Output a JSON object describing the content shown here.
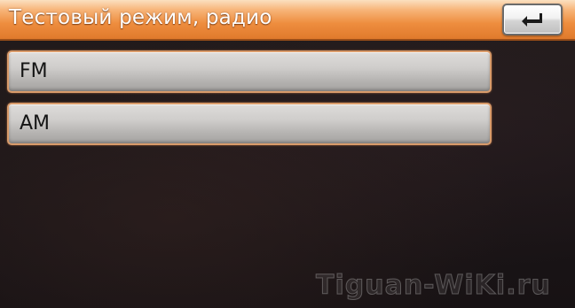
{
  "header": {
    "title": "Тестовый режим, радио",
    "back_icon": "back-return-icon"
  },
  "menu": {
    "items": [
      {
        "label": "FM"
      },
      {
        "label": "AM"
      }
    ]
  },
  "watermark": {
    "text": "Tiguan-WiKi.ru"
  },
  "colors": {
    "header_accent": "#ee8d3e",
    "button_border": "#d99b6a",
    "background": "#1b1618"
  }
}
